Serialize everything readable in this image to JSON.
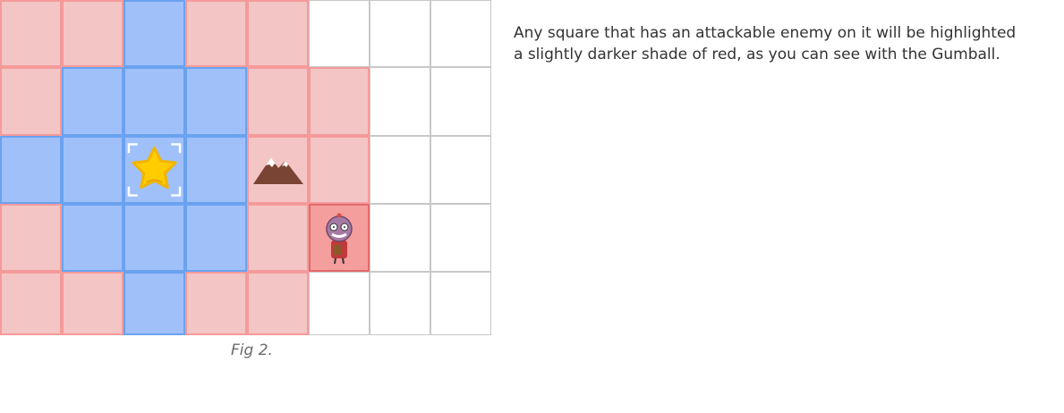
{
  "board": {
    "columns": 8,
    "rows": 5,
    "cells": [
      [
        "attack",
        "attack",
        "move",
        "attack",
        "attack",
        "empty",
        "empty",
        "empty"
      ],
      [
        "attack",
        "move",
        "move",
        "move",
        "attack",
        "attack",
        "empty",
        "empty"
      ],
      [
        "move",
        "move",
        "move",
        "move",
        "attack",
        "attack",
        "empty",
        "empty"
      ],
      [
        "attack",
        "move",
        "move",
        "move",
        "attack",
        "enemy",
        "empty",
        "empty"
      ],
      [
        "attack",
        "attack",
        "move",
        "attack",
        "attack",
        "empty",
        "empty",
        "empty"
      ]
    ],
    "pieces": [
      {
        "row": 2,
        "col": 2,
        "kind": "star",
        "icon": "star-unit-icon",
        "selected": true
      },
      {
        "row": 2,
        "col": 4,
        "kind": "mountain",
        "icon": "mountain-icon"
      },
      {
        "row": 3,
        "col": 5,
        "kind": "enemy",
        "icon": "gumball-enemy-icon"
      }
    ],
    "colors": {
      "attack": "#f4c5c5",
      "move": "#a0c0fa",
      "enemy": "#f59e9e",
      "empty": "#ffffff"
    }
  },
  "caption": "Fig 2.",
  "description": {
    "line1": "Any square that has an attackable enemy on it will be highlighted",
    "line2": "a slightly darker shade of red, as you can see with the Gumball."
  }
}
